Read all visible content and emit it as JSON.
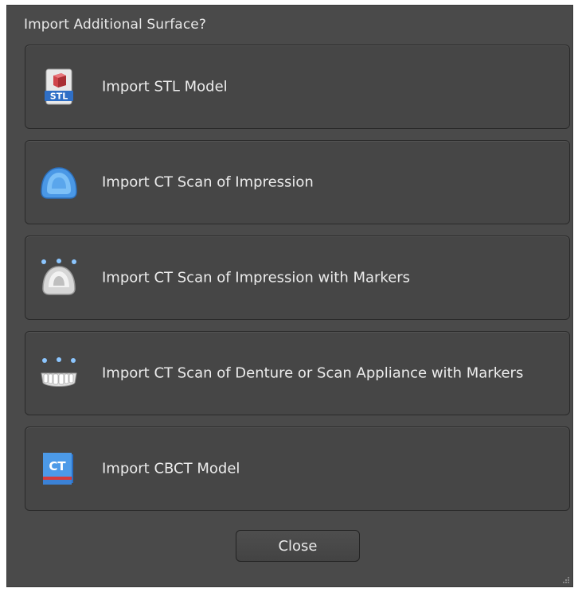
{
  "dialog": {
    "title": "Import Additional Surface?",
    "options": [
      {
        "label": "Import STL Model",
        "icon": "stl-file-icon"
      },
      {
        "label": "Import CT Scan of Impression",
        "icon": "impression-icon"
      },
      {
        "label": "Import CT Scan of Impression with Markers",
        "icon": "impression-markers-icon"
      },
      {
        "label": "Import CT Scan of Denture or Scan Appliance with Markers",
        "icon": "denture-markers-icon"
      },
      {
        "label": "Import CBCT Model",
        "icon": "cbct-icon"
      }
    ],
    "close_label": "Close",
    "stl_icon_text": "STL",
    "ct_icon_text": "CT"
  }
}
